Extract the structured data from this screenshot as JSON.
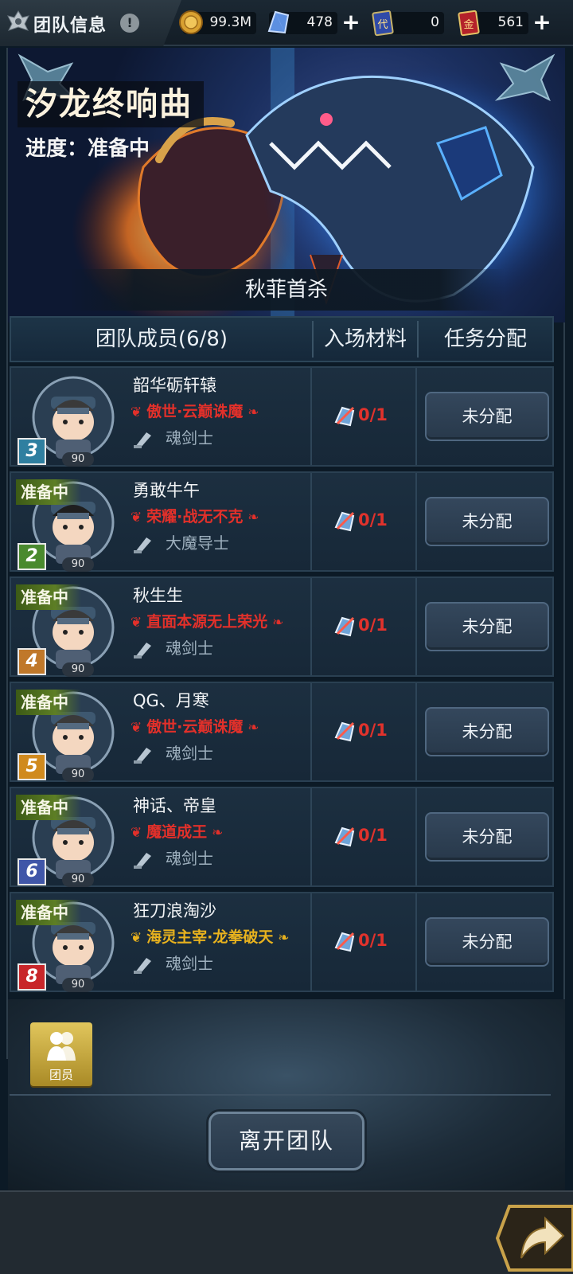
{
  "topbar": {
    "title": "团队信息",
    "info_icon_text": "!",
    "resources": [
      {
        "name": "gold-coin",
        "value": "99.3M",
        "has_plus": false
      },
      {
        "name": "crystal",
        "value": "478",
        "has_plus": true
      },
      {
        "name": "ticket-blue",
        "value": "0",
        "has_plus": false
      },
      {
        "name": "ticket-red",
        "value": "561",
        "has_plus": true
      }
    ],
    "blue_ticket_glyph": "代",
    "red_ticket_glyph": "金",
    "plus": "+"
  },
  "banner": {
    "raid_name": "汐龙终响曲",
    "progress": "进度：准备中",
    "first_kill": "秋菲首杀"
  },
  "table": {
    "col_members": "团队成员(6/8)",
    "col_materials": "入场材料",
    "col_tasks": "任务分配"
  },
  "members": [
    {
      "name": "韶华砺轩辕",
      "title": "傲世·云巅诛魔",
      "title_color": "#e2302a",
      "class": "魂剑士",
      "slot": "3",
      "slot_color": "#2f7fa0",
      "level": "90",
      "ready": "",
      "material": "0/1",
      "assign": "未分配"
    },
    {
      "name": "勇敢牛午",
      "title": "荣耀·战无不克",
      "title_color": "#e2302a",
      "class": "大魔导士",
      "slot": "2",
      "slot_color": "#4a8a2e",
      "level": "90",
      "ready": "准备中",
      "material": "0/1",
      "assign": "未分配"
    },
    {
      "name": "秋生生",
      "title": "直面本源无上荣光",
      "title_color": "#e2302a",
      "class": "魂剑士",
      "slot": "4",
      "slot_color": "#c0782a",
      "level": "90",
      "ready": "准备中",
      "material": "0/1",
      "assign": "未分配"
    },
    {
      "name": "QG、月寒",
      "title": "傲世·云巅诛魔",
      "title_color": "#e2302a",
      "class": "魂剑士",
      "slot": "5",
      "slot_color": "#d08a1e",
      "level": "90",
      "ready": "准备中",
      "material": "0/1",
      "assign": "未分配"
    },
    {
      "name": "神话、帝皇",
      "title": "魔道成王",
      "title_color": "#e2302a",
      "class": "魂剑士",
      "slot": "6",
      "slot_color": "#4056a8",
      "level": "90",
      "ready": "准备中",
      "material": "0/1",
      "assign": "未分配"
    },
    {
      "name": "狂刀浪淘沙",
      "title": "海灵主宰·龙拳破天",
      "title_color": "#e8b21e",
      "class": "魂剑士",
      "slot": "8",
      "slot_color": "#c8262a",
      "level": "90",
      "ready": "准备中",
      "material": "0/1",
      "assign": "未分配"
    }
  ],
  "bottom": {
    "member_button": "团员",
    "leave_button": "离开团队"
  }
}
